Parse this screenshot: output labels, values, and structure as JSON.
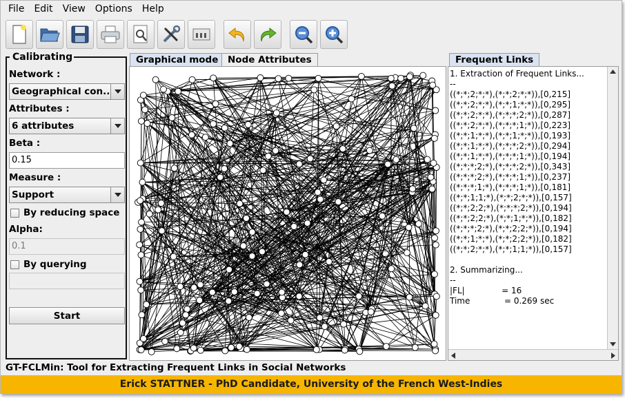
{
  "menu": [
    "File",
    "Edit",
    "View",
    "Options",
    "Help"
  ],
  "toolbar": {
    "buttons": [
      "new-file",
      "open-folder",
      "save-floppy",
      "print",
      "preview",
      "tools",
      "network-cards",
      "undo",
      "redo",
      "zoom-out",
      "zoom-in"
    ]
  },
  "calibrating": {
    "legend": "Calibrating",
    "network_label": "Network :",
    "network_value": "Geographical con...",
    "attributes_label": "Attributes :",
    "attributes_value": "6 attributes",
    "beta_label": "Beta :",
    "beta_value": "0.15",
    "measure_label": "Measure :",
    "measure_value": "Support",
    "reducing_label": "By reducing space",
    "alpha_label": "Alpha:",
    "alpha_value": "0.1",
    "querying_label": "By querying",
    "query_value": "",
    "start_label": "Start"
  },
  "tabs": {
    "graphical": "Graphical mode",
    "node_attributes": "Node Attributes",
    "frequent_links": "Frequent Links"
  },
  "frequent_links": {
    "lines": [
      "1. Extraction of Frequent Links...",
      "--",
      "((*;*;2;*;*),(*;*;2;*;*)),[0,215]",
      "((*;*;2;*;*),(*;*;1;*;*)),[0,295]",
      "((*;*;2;*;*),(*;*;*;2;*)),[0,287]",
      "((*;*;2;*;*),(*;*;*;1;*)),[0,223]",
      "((*;*;1;*;*),(*;*;1;*;*)),[0,193]",
      "((*;*;1;*;*),(*;*;*;2;*)),[0,294]",
      "((*;*;1;*;*),(*;*;*;1;*)),[0,194]",
      "((*;*;*;2;*),(*;*;*;2;*)),[0,343]",
      "((*;*;*;2;*),(*;*;*;1;*)),[0,237]",
      "((*;*;*;1;*),(*;*;*;1;*)),[0,181]",
      "((*;*;1;1;*),(*;*;2;*;*)),[0,157]",
      "((*;*;2;2;*),(*;*;*;2;*)),[0,194]",
      "((*;*;2;2;*),(*;*;1;*;*)),[0,182]",
      "((*;*;*;2;*),(*;*;2;2;*)),[0,194]",
      "((*;*;1;*;*),(*;*;2;2;*)),[0,182]",
      "((*;*;2;*;*),(*;*;1;1;*)),[0,157]",
      "",
      "2. Summarizing...",
      "--",
      "|FL|              = 16",
      "Time             = 0.269 sec"
    ]
  },
  "status_text": "GT-FCLMin: Tool for Extracting Frequent Links in Social Networks",
  "footer_text": "Erick STATTNER - PhD Candidate, University of the French West-Indies",
  "colors": {
    "footer": "#f7b500",
    "tab_active": "#d9e3f2",
    "panel_bg": "#eeeeee"
  }
}
